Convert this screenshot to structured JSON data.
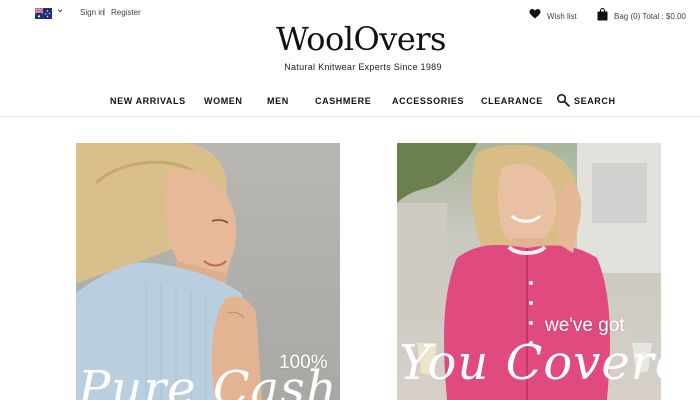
{
  "utility": {
    "country": "Australia",
    "sign_in": "Sign in",
    "separator": "|",
    "register": "Register",
    "wishlist": "Wish list",
    "bag": "Bag (0) Total : $0.00"
  },
  "brand": {
    "logo": "WoolOvers",
    "tagline": "Natural Knitwear Experts Since 1989"
  },
  "nav": {
    "items": [
      "NEW ARRIVALS",
      "WOMEN",
      "MEN",
      "CASHMERE",
      "ACCESSORIES",
      "CLEARANCE"
    ],
    "search": "SEARCH"
  },
  "tiles": {
    "left": {
      "headline": "100%",
      "script": "Pure Cashmere"
    },
    "right": {
      "headline": "we've got",
      "script": "You Covered"
    }
  },
  "colors": {
    "tile_left_sweater": "#b9cfe0",
    "tile_right_cardigan": "#e04a7e",
    "text": "#222222"
  }
}
